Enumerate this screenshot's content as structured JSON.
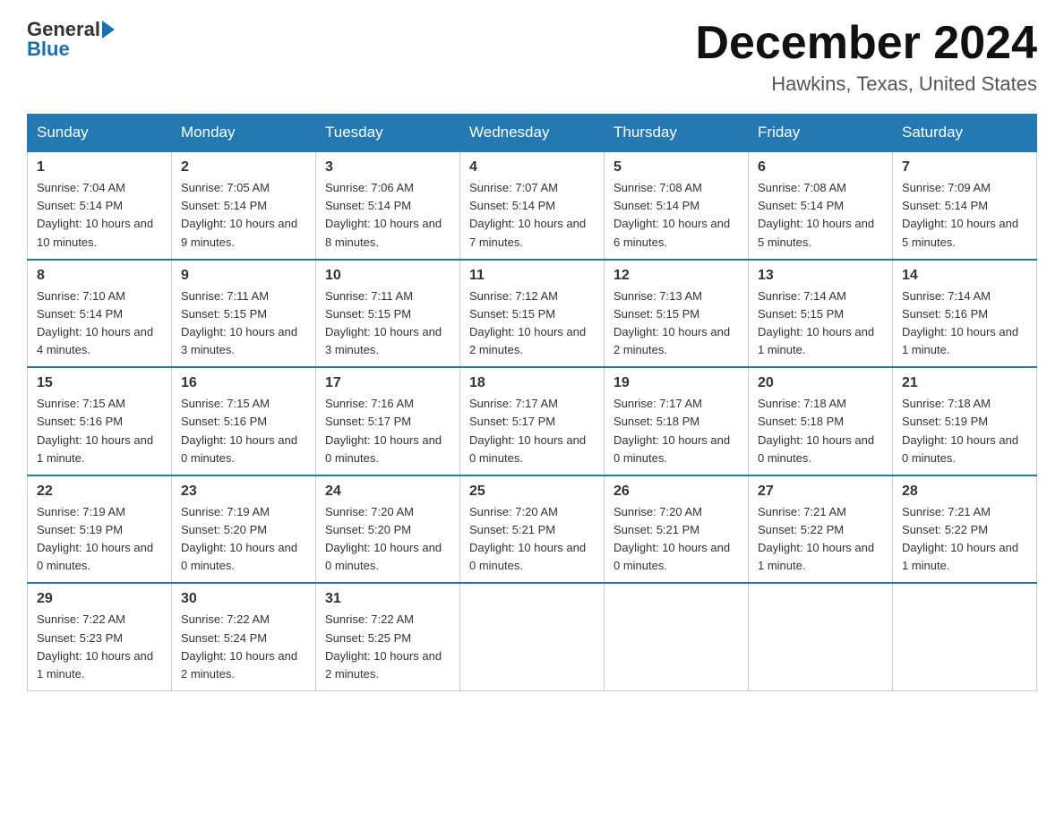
{
  "header": {
    "logo_general": "General",
    "logo_blue": "Blue",
    "month_title": "December 2024",
    "location": "Hawkins, Texas, United States"
  },
  "days_of_week": [
    "Sunday",
    "Monday",
    "Tuesday",
    "Wednesday",
    "Thursday",
    "Friday",
    "Saturday"
  ],
  "weeks": [
    [
      {
        "day": "1",
        "sunrise": "7:04 AM",
        "sunset": "5:14 PM",
        "daylight": "10 hours and 10 minutes."
      },
      {
        "day": "2",
        "sunrise": "7:05 AM",
        "sunset": "5:14 PM",
        "daylight": "10 hours and 9 minutes."
      },
      {
        "day": "3",
        "sunrise": "7:06 AM",
        "sunset": "5:14 PM",
        "daylight": "10 hours and 8 minutes."
      },
      {
        "day": "4",
        "sunrise": "7:07 AM",
        "sunset": "5:14 PM",
        "daylight": "10 hours and 7 minutes."
      },
      {
        "day": "5",
        "sunrise": "7:08 AM",
        "sunset": "5:14 PM",
        "daylight": "10 hours and 6 minutes."
      },
      {
        "day": "6",
        "sunrise": "7:08 AM",
        "sunset": "5:14 PM",
        "daylight": "10 hours and 5 minutes."
      },
      {
        "day": "7",
        "sunrise": "7:09 AM",
        "sunset": "5:14 PM",
        "daylight": "10 hours and 5 minutes."
      }
    ],
    [
      {
        "day": "8",
        "sunrise": "7:10 AM",
        "sunset": "5:14 PM",
        "daylight": "10 hours and 4 minutes."
      },
      {
        "day": "9",
        "sunrise": "7:11 AM",
        "sunset": "5:15 PM",
        "daylight": "10 hours and 3 minutes."
      },
      {
        "day": "10",
        "sunrise": "7:11 AM",
        "sunset": "5:15 PM",
        "daylight": "10 hours and 3 minutes."
      },
      {
        "day": "11",
        "sunrise": "7:12 AM",
        "sunset": "5:15 PM",
        "daylight": "10 hours and 2 minutes."
      },
      {
        "day": "12",
        "sunrise": "7:13 AM",
        "sunset": "5:15 PM",
        "daylight": "10 hours and 2 minutes."
      },
      {
        "day": "13",
        "sunrise": "7:14 AM",
        "sunset": "5:15 PM",
        "daylight": "10 hours and 1 minute."
      },
      {
        "day": "14",
        "sunrise": "7:14 AM",
        "sunset": "5:16 PM",
        "daylight": "10 hours and 1 minute."
      }
    ],
    [
      {
        "day": "15",
        "sunrise": "7:15 AM",
        "sunset": "5:16 PM",
        "daylight": "10 hours and 1 minute."
      },
      {
        "day": "16",
        "sunrise": "7:15 AM",
        "sunset": "5:16 PM",
        "daylight": "10 hours and 0 minutes."
      },
      {
        "day": "17",
        "sunrise": "7:16 AM",
        "sunset": "5:17 PM",
        "daylight": "10 hours and 0 minutes."
      },
      {
        "day": "18",
        "sunrise": "7:17 AM",
        "sunset": "5:17 PM",
        "daylight": "10 hours and 0 minutes."
      },
      {
        "day": "19",
        "sunrise": "7:17 AM",
        "sunset": "5:18 PM",
        "daylight": "10 hours and 0 minutes."
      },
      {
        "day": "20",
        "sunrise": "7:18 AM",
        "sunset": "5:18 PM",
        "daylight": "10 hours and 0 minutes."
      },
      {
        "day": "21",
        "sunrise": "7:18 AM",
        "sunset": "5:19 PM",
        "daylight": "10 hours and 0 minutes."
      }
    ],
    [
      {
        "day": "22",
        "sunrise": "7:19 AM",
        "sunset": "5:19 PM",
        "daylight": "10 hours and 0 minutes."
      },
      {
        "day": "23",
        "sunrise": "7:19 AM",
        "sunset": "5:20 PM",
        "daylight": "10 hours and 0 minutes."
      },
      {
        "day": "24",
        "sunrise": "7:20 AM",
        "sunset": "5:20 PM",
        "daylight": "10 hours and 0 minutes."
      },
      {
        "day": "25",
        "sunrise": "7:20 AM",
        "sunset": "5:21 PM",
        "daylight": "10 hours and 0 minutes."
      },
      {
        "day": "26",
        "sunrise": "7:20 AM",
        "sunset": "5:21 PM",
        "daylight": "10 hours and 0 minutes."
      },
      {
        "day": "27",
        "sunrise": "7:21 AM",
        "sunset": "5:22 PM",
        "daylight": "10 hours and 1 minute."
      },
      {
        "day": "28",
        "sunrise": "7:21 AM",
        "sunset": "5:22 PM",
        "daylight": "10 hours and 1 minute."
      }
    ],
    [
      {
        "day": "29",
        "sunrise": "7:22 AM",
        "sunset": "5:23 PM",
        "daylight": "10 hours and 1 minute."
      },
      {
        "day": "30",
        "sunrise": "7:22 AM",
        "sunset": "5:24 PM",
        "daylight": "10 hours and 2 minutes."
      },
      {
        "day": "31",
        "sunrise": "7:22 AM",
        "sunset": "5:25 PM",
        "daylight": "10 hours and 2 minutes."
      },
      null,
      null,
      null,
      null
    ]
  ]
}
